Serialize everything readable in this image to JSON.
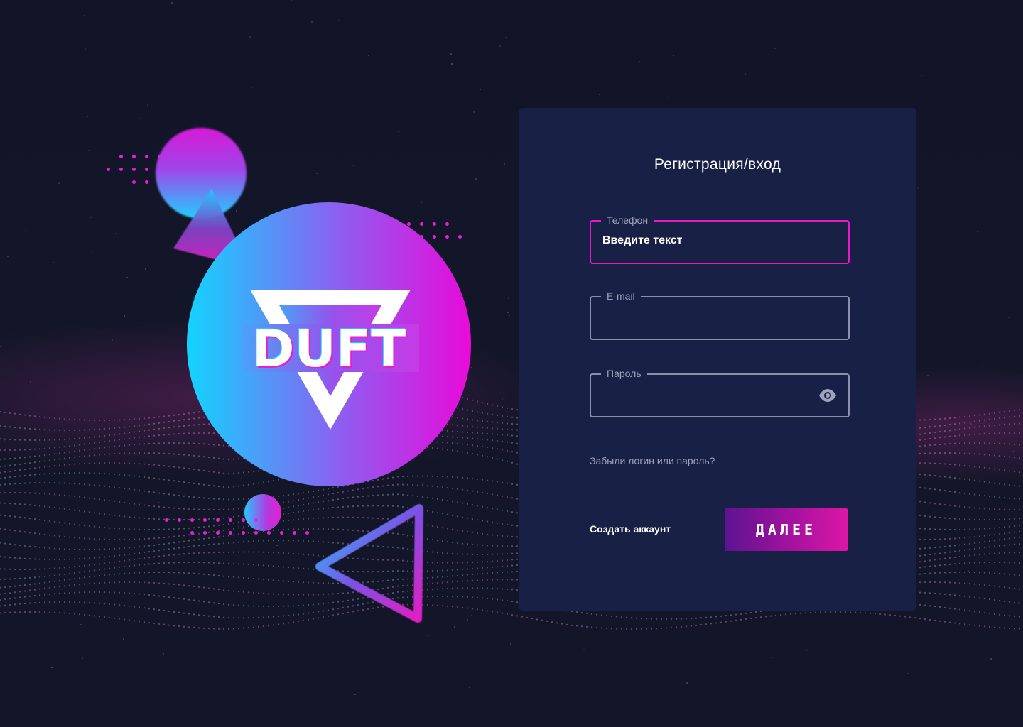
{
  "logo": {
    "text": "DUFT"
  },
  "form": {
    "title": "Регистрация/вход",
    "phone": {
      "label": "Телефон",
      "value": "Введите текст"
    },
    "email": {
      "label": "E-mail",
      "value": ""
    },
    "password": {
      "label": "Пароль",
      "value": "",
      "icon": "eye-icon"
    },
    "forgot_link": "Забыли логин или пароль?",
    "create_account": "Создать аккаунт",
    "next_button": "ДАЛЕЕ"
  },
  "colors": {
    "background": "#12152a",
    "card": "#182045",
    "accent_pink": "#ea18c9",
    "accent_cyan": "#12d4ff",
    "button_from": "#5d1390",
    "button_to": "#dd16a6"
  }
}
